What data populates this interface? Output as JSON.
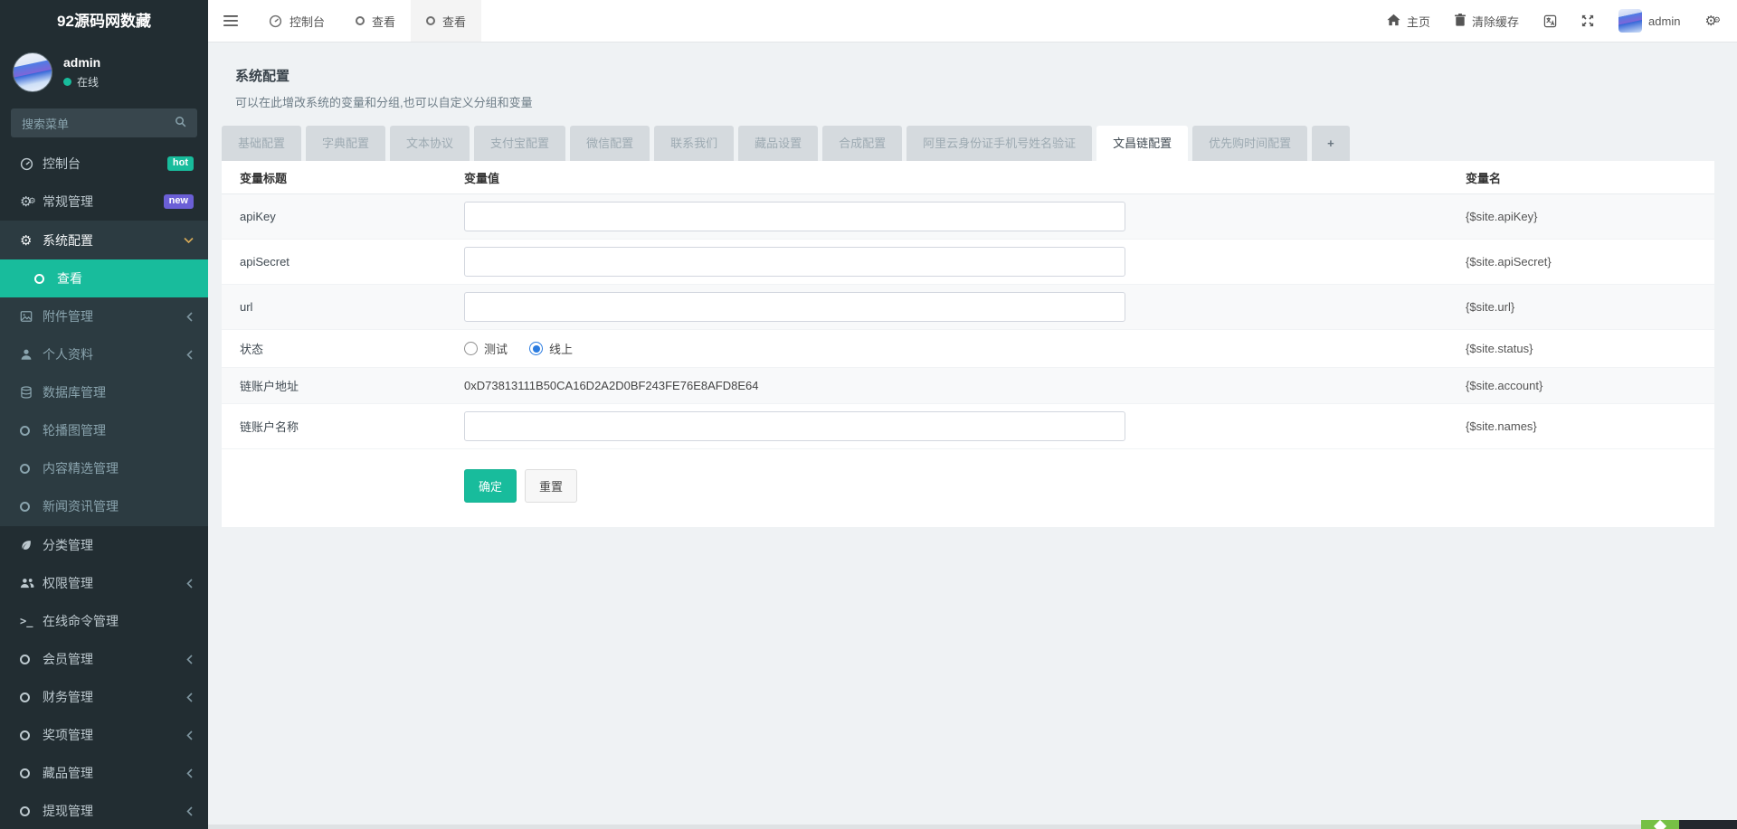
{
  "app": {
    "logo": "92源码网数藏"
  },
  "colors": {
    "accent_teal": "#18bc9c",
    "badge_hot": "#18bc9c",
    "badge_new": "#6b5fd6",
    "radio_blue": "#2b7ce0",
    "sidebar_bg": "#222d32",
    "submenu_bg": "#2c3b41"
  },
  "sidebar": {
    "user": {
      "name": "admin",
      "status": "在线"
    },
    "search_placeholder": "搜索菜单",
    "menu": [
      {
        "key": "console",
        "label": "控制台",
        "icon": "dashboard",
        "badge": "hot",
        "badge_color": "#18bc9c"
      },
      {
        "key": "general",
        "label": "常规管理",
        "icon": "gears",
        "badge": "new",
        "badge_color": "#6b5fd6"
      },
      {
        "key": "config",
        "label": "系统配置",
        "icon": "gear",
        "sub": true,
        "expanded": true
      },
      {
        "key": "view",
        "label": "查看",
        "icon": "circle",
        "sub": true,
        "child": true,
        "active": true
      },
      {
        "key": "attachment",
        "label": "附件管理",
        "icon": "file-image",
        "sub": true,
        "chevron": true
      },
      {
        "key": "profile",
        "label": "个人资料",
        "icon": "user",
        "sub": true,
        "chevron": true
      },
      {
        "key": "database",
        "label": "数据库管理",
        "icon": "database",
        "sub": true
      },
      {
        "key": "banner",
        "label": "轮播图管理",
        "icon": "circle",
        "sub": true
      },
      {
        "key": "featured",
        "label": "内容精选管理",
        "icon": "circle",
        "sub": true
      },
      {
        "key": "news",
        "label": "新闻资讯管理",
        "icon": "circle",
        "sub": true
      },
      {
        "key": "category",
        "label": "分类管理",
        "icon": "leaf"
      },
      {
        "key": "auth",
        "label": "权限管理",
        "icon": "users",
        "chevron": true
      },
      {
        "key": "command",
        "label": "在线命令管理",
        "icon": "terminal"
      },
      {
        "key": "member",
        "label": "会员管理",
        "icon": "circle",
        "chevron": true
      },
      {
        "key": "finance",
        "label": "财务管理",
        "icon": "circle",
        "chevron": true
      },
      {
        "key": "award",
        "label": "奖项管理",
        "icon": "circle",
        "chevron": true
      },
      {
        "key": "collection",
        "label": "藏品管理",
        "icon": "circle",
        "chevron": true
      },
      {
        "key": "withdraw",
        "label": "提现管理",
        "icon": "circle",
        "chevron": true
      }
    ]
  },
  "topbar": {
    "tabs": [
      {
        "label": "控制台",
        "icon": "dashboard"
      },
      {
        "label": "查看",
        "icon": "circle"
      },
      {
        "label": "查看",
        "icon": "circle",
        "active": true
      }
    ],
    "right": {
      "home": "主页",
      "clear_cache": "清除缓存",
      "user": "admin"
    }
  },
  "page": {
    "title": "系统配置",
    "subtitle": "可以在此增改系统的变量和分组,也可以自定义分组和变量",
    "tabs": [
      {
        "label": "基础配置"
      },
      {
        "label": "字典配置"
      },
      {
        "label": "文本协议"
      },
      {
        "label": "支付宝配置"
      },
      {
        "label": "微信配置"
      },
      {
        "label": "联系我们"
      },
      {
        "label": "藏品设置"
      },
      {
        "label": "合成配置"
      },
      {
        "label": "阿里云身份证手机号姓名验证"
      },
      {
        "label": "文昌链配置",
        "active": true
      },
      {
        "label": "优先购时间配置"
      },
      {
        "label": "+",
        "add": true
      }
    ],
    "table": {
      "headers": [
        "变量标题",
        "变量值",
        "变量名"
      ],
      "rows": [
        {
          "title": "apiKey",
          "type": "input",
          "value": "",
          "var": "{$site.apiKey}"
        },
        {
          "title": "apiSecret",
          "type": "input",
          "value": "",
          "var": "{$site.apiSecret}"
        },
        {
          "title": "url",
          "type": "input",
          "value": "",
          "var": "{$site.url}"
        },
        {
          "title": "状态",
          "type": "radio",
          "options": [
            "测试",
            "线上"
          ],
          "selected": "线上",
          "var": "{$site.status}"
        },
        {
          "title": "链账户地址",
          "type": "text",
          "value": "0xD73813111B50CA16D2A2D0BF243FE76E8AFD8E64",
          "var": "{$site.account}"
        },
        {
          "title": "链账户名称",
          "type": "input",
          "value": "",
          "var": "{$site.names}"
        }
      ]
    },
    "buttons": {
      "ok": "确定",
      "reset": "重置"
    }
  }
}
